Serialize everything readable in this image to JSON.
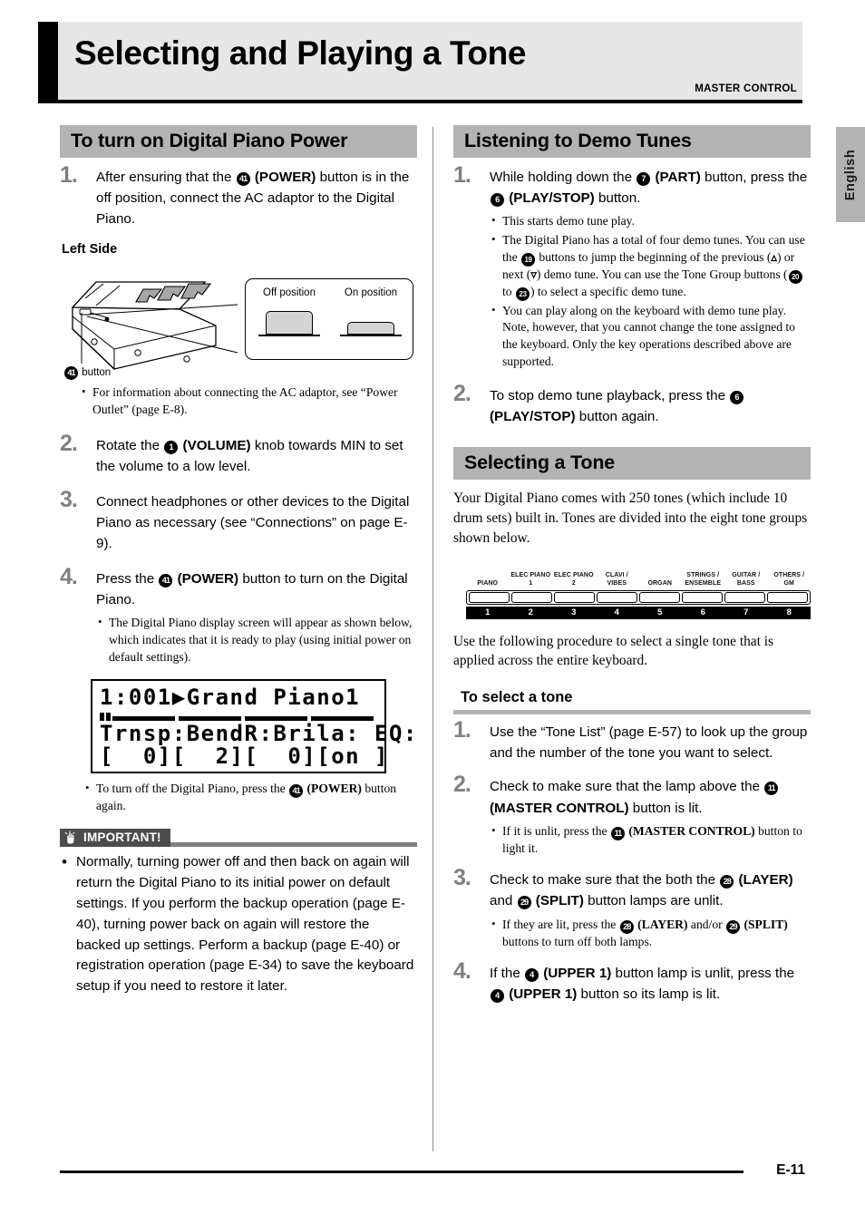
{
  "header": {
    "title": "Selecting and Playing a Tone",
    "subtitle": "MASTER CONTROL"
  },
  "lang_tab": {
    "label": "English"
  },
  "footer": {
    "page": "E-11"
  },
  "left_column": {
    "section_title": "To turn on Digital Piano Power",
    "step1": {
      "num": "1.",
      "text_a": "After ensuring that the ",
      "badge": "41",
      "text_b": " (POWER)",
      "text_c": " button is in the off position, connect the AC adaptor to the Digital Piano."
    },
    "illustration": {
      "caption": "Left Side",
      "button_callout_badge": "41",
      "button_callout_text": "button",
      "off_label": "Off position",
      "on_label": "On position"
    },
    "note_ac": "For information about connecting the AC adaptor, see “Power Outlet” (page E-8).",
    "step2": {
      "num": "2.",
      "text_a": "Rotate the ",
      "badge": "1",
      "text_b": " (VOLUME)",
      "text_c": " knob towards MIN to set the volume to a low level."
    },
    "step3": {
      "num": "3.",
      "text": "Connect headphones or other devices to the Digital Piano as necessary (see “Connections” on page E-9)."
    },
    "step4": {
      "num": "4.",
      "text_a": "Press the ",
      "badge": "41",
      "text_b": " (POWER)",
      "text_c": " button to turn on the Digital Piano.",
      "note": "The Digital Piano display screen will appear as shown below, which indicates that it is ready to play (using initial power on default settings)."
    },
    "lcd": {
      "line1": "1:001▶Grand Piano1",
      "line2": "Trnsp:BendR:Brila: EQ:",
      "line3": "[  0][  2][  0][on ]"
    },
    "note_poweroff_a": "To turn off the Digital Piano, press the ",
    "note_poweroff_badge": "41",
    "note_poweroff_b": " (POWER)",
    "note_poweroff_c": " button again.",
    "important": {
      "badge_label": "IMPORTANT!",
      "body": "Normally, turning power off and then back on again will return the Digital Piano to its initial power on default settings. If you perform the backup operation (page E-40), turning power back on again will restore the backed up settings. Perform a backup (page E-40) or registration operation (page E-34) to save the keyboard setup if you need to restore it later."
    }
  },
  "right_column": {
    "demo_section_title": "Listening to Demo Tunes",
    "demo_step1": {
      "num": "1.",
      "text_a": "While holding down the ",
      "badge1": "7",
      "text_b": " (PART)",
      "text_c": " button, press the ",
      "badge2": "6",
      "text_d": " (PLAY/STOP)",
      "text_e": " button.",
      "bullets": [
        "This starts demo tune play.",
        "The Digital Piano has a total of four demo tunes. You can use the   buttons to jump the beginning of the previous (∧) or next (∨) demo tune. You can use the Tone Group buttons ( to ) to select a specific demo tune.",
        "You can play along on the keyboard with demo tune play. Note, however, that you cannot change the tone assigned to the keyboard. Only the key operations described above are supported."
      ],
      "bullet2_badges": {
        "nav": "19",
        "group_from": "20",
        "group_to": "23"
      }
    },
    "demo_step2": {
      "num": "2.",
      "text_a": "To stop demo tune playback, press the ",
      "badge": "6",
      "text_b": " (PLAY/STOP)",
      "text_c": " button again."
    },
    "tone_section_title": "Selecting a Tone",
    "tone_intro": "Your Digital Piano comes with 250 tones (which include 10 drum sets) built in. Tones are divided into the eight tone groups shown below.",
    "tone_panel": {
      "labels": [
        "PIANO",
        "ELEC PIANO 1",
        "ELEC PIANO 2",
        "CLAVI / VIBES",
        "ORGAN",
        "STRINGS /\nENSEMBLE",
        "GUITAR /\nBASS",
        "OTHERS /\nGM"
      ],
      "numbers": [
        "1",
        "2",
        "3",
        "4",
        "5",
        "6",
        "7",
        "8"
      ]
    },
    "tone_after": "Use the following procedure to select a single tone that is applied across the entire keyboard.",
    "subsection_title": "To select a tone",
    "sel_step1": {
      "num": "1.",
      "text": "Use the “Tone List” (page E-57) to look up the group and the number of the tone you want to select."
    },
    "sel_step2": {
      "num": "2.",
      "text_a": "Check to make sure that the lamp above the ",
      "badge": "11",
      "text_b": " (MASTER CONTROL)",
      "text_c": " button is lit.",
      "note_a": "If it is unlit, press the ",
      "note_badge": "11",
      "note_b": " (MASTER CONTROL)",
      "note_c": " button to light it."
    },
    "sel_step3": {
      "num": "3.",
      "text_a": "Check to make sure that the both the ",
      "badge1": "28",
      "text_b": " (LAYER)",
      "text_c": " and ",
      "badge2": "29",
      "text_d": " (SPLIT)",
      "text_e": " button lamps are unlit.",
      "note_a": "If they are lit, press the ",
      "note_badge1": "28",
      "note_b": " (LAYER)",
      "note_c": " and/or ",
      "note_badge2": "29",
      "note_d": " (SPLIT)",
      "note_e": " buttons to turn off both lamps."
    },
    "sel_step4": {
      "num": "4.",
      "text_a": "If the ",
      "badge1": "4",
      "text_b": " (UPPER 1)",
      "text_c": " button lamp is unlit, press the ",
      "badge2": "4",
      "text_d": " (UPPER 1)",
      "text_e": " button so its lamp is lit."
    }
  }
}
